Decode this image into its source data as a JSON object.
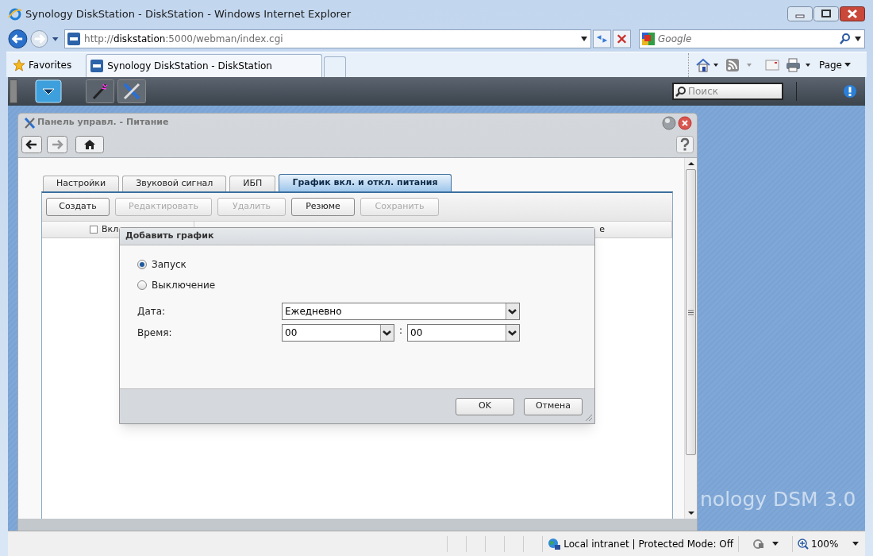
{
  "browser": {
    "title": "Synology DiskStation - DiskStation - Windows Internet Explorer",
    "address": {
      "prefix": "http://",
      "host": "diskstation",
      "rest": ":5000/webman/index.cgi"
    },
    "search_placeholder": "Google",
    "favorites": "Favorites",
    "tabs": [
      {
        "label": "Synology DiskStation - DiskStation",
        "selected": true
      }
    ],
    "page_menu": "Page"
  },
  "dsm": {
    "search_placeholder": "Поиск",
    "desktop_logo": "nology DSM 3.0"
  },
  "window": {
    "title": "Панель управл. - Питание",
    "tabs": [
      {
        "label": "Настройки",
        "selected": false
      },
      {
        "label": "Звуковой сигнал",
        "selected": false
      },
      {
        "label": "ИБП",
        "selected": false
      },
      {
        "label": "График вкл. и откл. питания",
        "selected": true
      }
    ],
    "toolbar": [
      {
        "label": "Создать",
        "disabled": false
      },
      {
        "label": "Редактировать",
        "disabled": true
      },
      {
        "label": "Удалить",
        "disabled": true
      },
      {
        "label": "Резюме",
        "disabled": false
      },
      {
        "label": "Сохранить",
        "disabled": true
      }
    ],
    "columns": [
      {
        "header": "Вкл",
        "checked": false
      },
      {
        "header": "е"
      }
    ]
  },
  "dialog": {
    "title": "Добавить график",
    "radios": [
      {
        "label": "Запуск",
        "selected": true
      },
      {
        "label": "Выключение",
        "selected": false
      }
    ],
    "fields": [
      {
        "label": "Дата:",
        "values": [
          "Ежедневно"
        ]
      },
      {
        "label": "Время:",
        "values": [
          "00",
          "00"
        ],
        "separator": ":"
      }
    ],
    "buttons": [
      "OK",
      "Отмена"
    ]
  },
  "status_bar": {
    "zone": "Local intranet | Protected Mode: Off",
    "zoom": "100%"
  }
}
